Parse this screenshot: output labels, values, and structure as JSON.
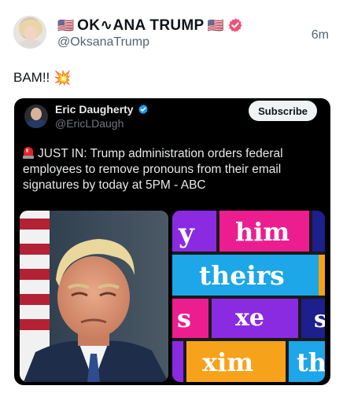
{
  "post": {
    "flag_left": "🇺🇸",
    "display_name": "OK∿ANA TRUMP",
    "flag_right": "🇺🇸",
    "handle": "@OksanaTrump",
    "time": "6m",
    "text": "BAM!!",
    "emoji": "💥",
    "verified_icon": "verified-badge-icon"
  },
  "quoted": {
    "name": "Eric Daugherty",
    "handle": "@EricLDaugh",
    "subscribe_label": "Subscribe",
    "text": "JUST IN: Trump administration orders federal employees to remove pronouns from their email signatures by today at 5PM - ABC",
    "siren_icon": "siren-icon"
  },
  "media_right": {
    "words": [
      "y",
      "him",
      "theirs",
      "s",
      "xe",
      "s",
      "xim",
      "th"
    ]
  },
  "colors": {
    "verified_post": "#f0517a",
    "verified_quote": "#1d9bf0",
    "pink": "#ec1e8f",
    "purple": "#8a2be2",
    "blue": "#1da6e8",
    "orange": "#f7a21b",
    "navy": "#1c1f8c"
  }
}
